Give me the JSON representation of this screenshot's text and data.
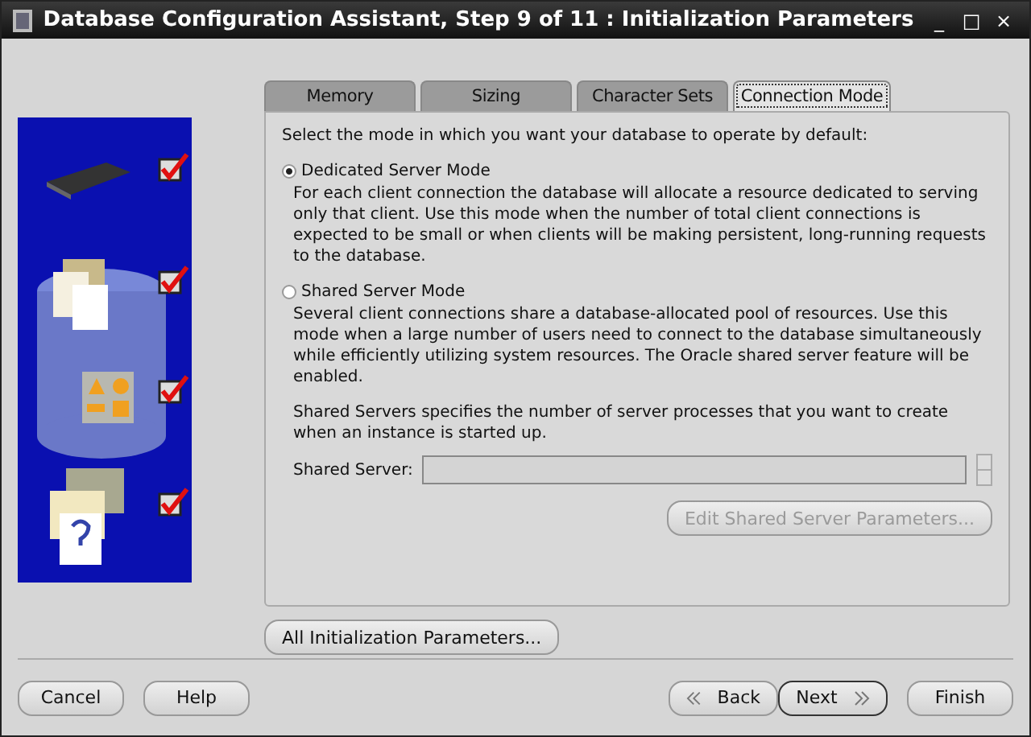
{
  "window": {
    "title": "Database Configuration Assistant, Step 9 of 11 : Initialization Parameters",
    "controls": [
      "_",
      "□",
      "×"
    ]
  },
  "steps": [
    {
      "kind": "chip",
      "checked": true
    },
    {
      "kind": "docs",
      "checked": true
    },
    {
      "kind": "shapes",
      "checked": true
    },
    {
      "kind": "help",
      "checked": true
    }
  ],
  "tabs": [
    {
      "label": "Memory",
      "selected": false
    },
    {
      "label": "Sizing",
      "selected": false
    },
    {
      "label": "Character Sets",
      "selected": false
    },
    {
      "label": "Connection Mode",
      "selected": true
    }
  ],
  "intro": "Select the mode in which you want your database to operate by default:",
  "modes": [
    {
      "label": "Dedicated Server Mode",
      "selected": true,
      "description": "For each client connection the database will allocate a resource dedicated to serving only that client.  Use this mode when the number of total client connections is expected to be small or when clients will be making persistent, long-running requests to the database."
    },
    {
      "label": "Shared Server Mode",
      "selected": false,
      "description": "Several client connections share a database-allocated pool of resources.  Use this mode when a large number of users need to connect to the database simultaneously while efficiently utilizing system resources.  The Oracle shared server feature will be enabled."
    }
  ],
  "shared_note": "Shared Servers specifies the number of server processes that you want to create when an instance is started up.",
  "shared_server": {
    "label": "Shared Server:",
    "disabled": true
  },
  "edit_button": {
    "label": "Edit Shared Server Parameters...",
    "disabled": true
  },
  "all_params_button": "All Initialization Parameters...",
  "footer": {
    "left": [
      "Cancel",
      "Help"
    ],
    "back": "Back",
    "next": "Next",
    "finish": "Finish"
  }
}
